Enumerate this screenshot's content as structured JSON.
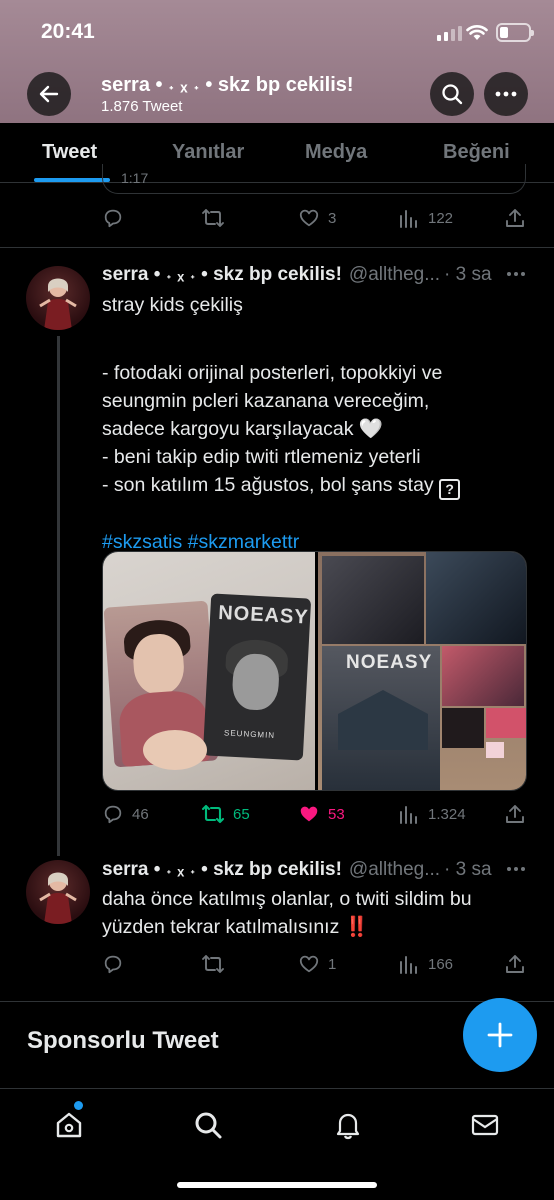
{
  "status_bar": {
    "time": "20:41"
  },
  "header": {
    "name": "serra • ˖ ₓ ˖ • skz bp cekilis!",
    "tweet_count": "1.876 Tweet"
  },
  "tabs": [
    {
      "label": "Tweet",
      "active": true
    },
    {
      "label": "Yanıtlar",
      "active": false
    },
    {
      "label": "Medya",
      "active": false
    },
    {
      "label": "Beğeni",
      "active": false
    }
  ],
  "prev_tweet": {
    "card_text": "1:17",
    "replies": "",
    "retweets": "",
    "likes": "3",
    "views": "122"
  },
  "tweet1": {
    "name": "serra • ˖ ₓ ˖ • skz bp cekilis!",
    "handle": "@alltheg...",
    "time": "· 3 sa",
    "lines": [
      "stray kids çekiliş",
      "",
      "- fotodaki orijinal posterleri, topokkiyi ve",
      "seungmin pcleri kazanana vereceğim,",
      "sadece kargoyu karşılayacak 🤍",
      "- beni takip edip twiti rtlemeniz yeterli",
      "- son katılım 15 ağustos, bol şans stay"
    ],
    "unknown_glyph": "?",
    "hashtags": "#skzsatis #skzmarkettr",
    "photo1": {
      "poster_title": "NOEASY",
      "card_name": "SEUNGMIN"
    },
    "photo2": {
      "poster_title": "NOEASY"
    },
    "replies": "46",
    "retweets": "65",
    "likes": "53",
    "views": "1.324"
  },
  "tweet2": {
    "name": "serra • ˖ ₓ ˖ • skz bp cekilis!",
    "handle": "@alltheg...",
    "time": "· 3 sa",
    "lines": [
      "daha önce katılmış olanlar, o twiti sildim bu",
      "yüzden tekrar katılmalısınız ‼️"
    ],
    "replies": "",
    "retweets": "",
    "likes": "1",
    "views": "166"
  },
  "sponsored": {
    "label": "Sponsorlu Tweet"
  },
  "colors": {
    "accent": "#1d9bf0",
    "retweet_active": "#00ba7c",
    "like_active": "#f91880",
    "muted": "#71767b"
  },
  "icons": {
    "nav": [
      "home-icon",
      "search-icon",
      "bell-icon",
      "mail-icon"
    ],
    "fab": "plus-icon"
  }
}
